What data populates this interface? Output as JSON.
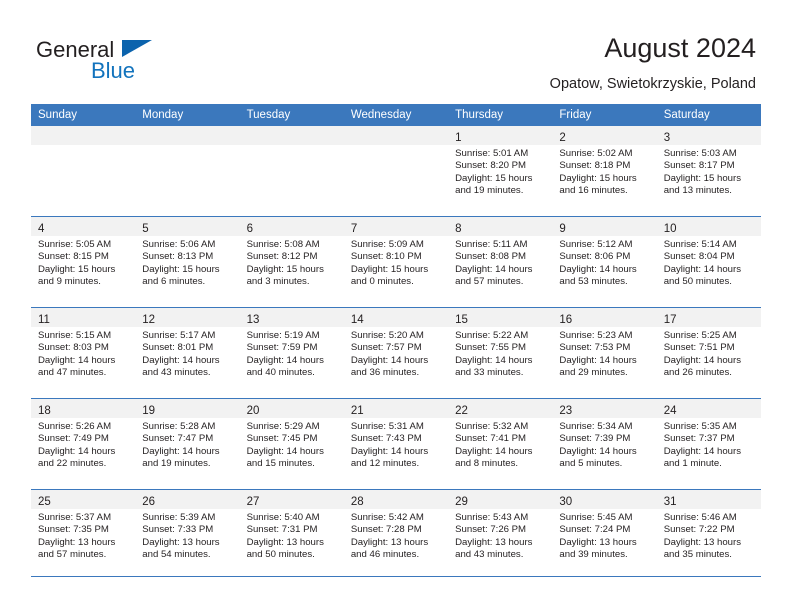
{
  "brand": {
    "line1": "General",
    "line2": "Blue",
    "flag_color": "#0b63ad",
    "blue_text_color": "#1273bd"
  },
  "header": {
    "title": "August 2024",
    "subtitle": "Opatow, Swietokrzyskie, Poland"
  },
  "theme": {
    "header_blue": "#3b78bd",
    "cell_header_gray": "#f2f2f2",
    "text_color": "#231f20"
  },
  "weekdays": [
    "Sunday",
    "Monday",
    "Tuesday",
    "Wednesday",
    "Thursday",
    "Friday",
    "Saturday"
  ],
  "weeks": [
    [
      {
        "day": "",
        "sunrise": "",
        "sunset": "",
        "daylight1": "",
        "daylight2": ""
      },
      {
        "day": "",
        "sunrise": "",
        "sunset": "",
        "daylight1": "",
        "daylight2": ""
      },
      {
        "day": "",
        "sunrise": "",
        "sunset": "",
        "daylight1": "",
        "daylight2": ""
      },
      {
        "day": "",
        "sunrise": "",
        "sunset": "",
        "daylight1": "",
        "daylight2": ""
      },
      {
        "day": "1",
        "sunrise": "Sunrise: 5:01 AM",
        "sunset": "Sunset: 8:20 PM",
        "daylight1": "Daylight: 15 hours",
        "daylight2": "and 19 minutes."
      },
      {
        "day": "2",
        "sunrise": "Sunrise: 5:02 AM",
        "sunset": "Sunset: 8:18 PM",
        "daylight1": "Daylight: 15 hours",
        "daylight2": "and 16 minutes."
      },
      {
        "day": "3",
        "sunrise": "Sunrise: 5:03 AM",
        "sunset": "Sunset: 8:17 PM",
        "daylight1": "Daylight: 15 hours",
        "daylight2": "and 13 minutes."
      }
    ],
    [
      {
        "day": "4",
        "sunrise": "Sunrise: 5:05 AM",
        "sunset": "Sunset: 8:15 PM",
        "daylight1": "Daylight: 15 hours",
        "daylight2": "and 9 minutes."
      },
      {
        "day": "5",
        "sunrise": "Sunrise: 5:06 AM",
        "sunset": "Sunset: 8:13 PM",
        "daylight1": "Daylight: 15 hours",
        "daylight2": "and 6 minutes."
      },
      {
        "day": "6",
        "sunrise": "Sunrise: 5:08 AM",
        "sunset": "Sunset: 8:12 PM",
        "daylight1": "Daylight: 15 hours",
        "daylight2": "and 3 minutes."
      },
      {
        "day": "7",
        "sunrise": "Sunrise: 5:09 AM",
        "sunset": "Sunset: 8:10 PM",
        "daylight1": "Daylight: 15 hours",
        "daylight2": "and 0 minutes."
      },
      {
        "day": "8",
        "sunrise": "Sunrise: 5:11 AM",
        "sunset": "Sunset: 8:08 PM",
        "daylight1": "Daylight: 14 hours",
        "daylight2": "and 57 minutes."
      },
      {
        "day": "9",
        "sunrise": "Sunrise: 5:12 AM",
        "sunset": "Sunset: 8:06 PM",
        "daylight1": "Daylight: 14 hours",
        "daylight2": "and 53 minutes."
      },
      {
        "day": "10",
        "sunrise": "Sunrise: 5:14 AM",
        "sunset": "Sunset: 8:04 PM",
        "daylight1": "Daylight: 14 hours",
        "daylight2": "and 50 minutes."
      }
    ],
    [
      {
        "day": "11",
        "sunrise": "Sunrise: 5:15 AM",
        "sunset": "Sunset: 8:03 PM",
        "daylight1": "Daylight: 14 hours",
        "daylight2": "and 47 minutes."
      },
      {
        "day": "12",
        "sunrise": "Sunrise: 5:17 AM",
        "sunset": "Sunset: 8:01 PM",
        "daylight1": "Daylight: 14 hours",
        "daylight2": "and 43 minutes."
      },
      {
        "day": "13",
        "sunrise": "Sunrise: 5:19 AM",
        "sunset": "Sunset: 7:59 PM",
        "daylight1": "Daylight: 14 hours",
        "daylight2": "and 40 minutes."
      },
      {
        "day": "14",
        "sunrise": "Sunrise: 5:20 AM",
        "sunset": "Sunset: 7:57 PM",
        "daylight1": "Daylight: 14 hours",
        "daylight2": "and 36 minutes."
      },
      {
        "day": "15",
        "sunrise": "Sunrise: 5:22 AM",
        "sunset": "Sunset: 7:55 PM",
        "daylight1": "Daylight: 14 hours",
        "daylight2": "and 33 minutes."
      },
      {
        "day": "16",
        "sunrise": "Sunrise: 5:23 AM",
        "sunset": "Sunset: 7:53 PM",
        "daylight1": "Daylight: 14 hours",
        "daylight2": "and 29 minutes."
      },
      {
        "day": "17",
        "sunrise": "Sunrise: 5:25 AM",
        "sunset": "Sunset: 7:51 PM",
        "daylight1": "Daylight: 14 hours",
        "daylight2": "and 26 minutes."
      }
    ],
    [
      {
        "day": "18",
        "sunrise": "Sunrise: 5:26 AM",
        "sunset": "Sunset: 7:49 PM",
        "daylight1": "Daylight: 14 hours",
        "daylight2": "and 22 minutes."
      },
      {
        "day": "19",
        "sunrise": "Sunrise: 5:28 AM",
        "sunset": "Sunset: 7:47 PM",
        "daylight1": "Daylight: 14 hours",
        "daylight2": "and 19 minutes."
      },
      {
        "day": "20",
        "sunrise": "Sunrise: 5:29 AM",
        "sunset": "Sunset: 7:45 PM",
        "daylight1": "Daylight: 14 hours",
        "daylight2": "and 15 minutes."
      },
      {
        "day": "21",
        "sunrise": "Sunrise: 5:31 AM",
        "sunset": "Sunset: 7:43 PM",
        "daylight1": "Daylight: 14 hours",
        "daylight2": "and 12 minutes."
      },
      {
        "day": "22",
        "sunrise": "Sunrise: 5:32 AM",
        "sunset": "Sunset: 7:41 PM",
        "daylight1": "Daylight: 14 hours",
        "daylight2": "and 8 minutes."
      },
      {
        "day": "23",
        "sunrise": "Sunrise: 5:34 AM",
        "sunset": "Sunset: 7:39 PM",
        "daylight1": "Daylight: 14 hours",
        "daylight2": "and 5 minutes."
      },
      {
        "day": "24",
        "sunrise": "Sunrise: 5:35 AM",
        "sunset": "Sunset: 7:37 PM",
        "daylight1": "Daylight: 14 hours",
        "daylight2": "and 1 minute."
      }
    ],
    [
      {
        "day": "25",
        "sunrise": "Sunrise: 5:37 AM",
        "sunset": "Sunset: 7:35 PM",
        "daylight1": "Daylight: 13 hours",
        "daylight2": "and 57 minutes."
      },
      {
        "day": "26",
        "sunrise": "Sunrise: 5:39 AM",
        "sunset": "Sunset: 7:33 PM",
        "daylight1": "Daylight: 13 hours",
        "daylight2": "and 54 minutes."
      },
      {
        "day": "27",
        "sunrise": "Sunrise: 5:40 AM",
        "sunset": "Sunset: 7:31 PM",
        "daylight1": "Daylight: 13 hours",
        "daylight2": "and 50 minutes."
      },
      {
        "day": "28",
        "sunrise": "Sunrise: 5:42 AM",
        "sunset": "Sunset: 7:28 PM",
        "daylight1": "Daylight: 13 hours",
        "daylight2": "and 46 minutes."
      },
      {
        "day": "29",
        "sunrise": "Sunrise: 5:43 AM",
        "sunset": "Sunset: 7:26 PM",
        "daylight1": "Daylight: 13 hours",
        "daylight2": "and 43 minutes."
      },
      {
        "day": "30",
        "sunrise": "Sunrise: 5:45 AM",
        "sunset": "Sunset: 7:24 PM",
        "daylight1": "Daylight: 13 hours",
        "daylight2": "and 39 minutes."
      },
      {
        "day": "31",
        "sunrise": "Sunrise: 5:46 AM",
        "sunset": "Sunset: 7:22 PM",
        "daylight1": "Daylight: 13 hours",
        "daylight2": "and 35 minutes."
      }
    ]
  ]
}
